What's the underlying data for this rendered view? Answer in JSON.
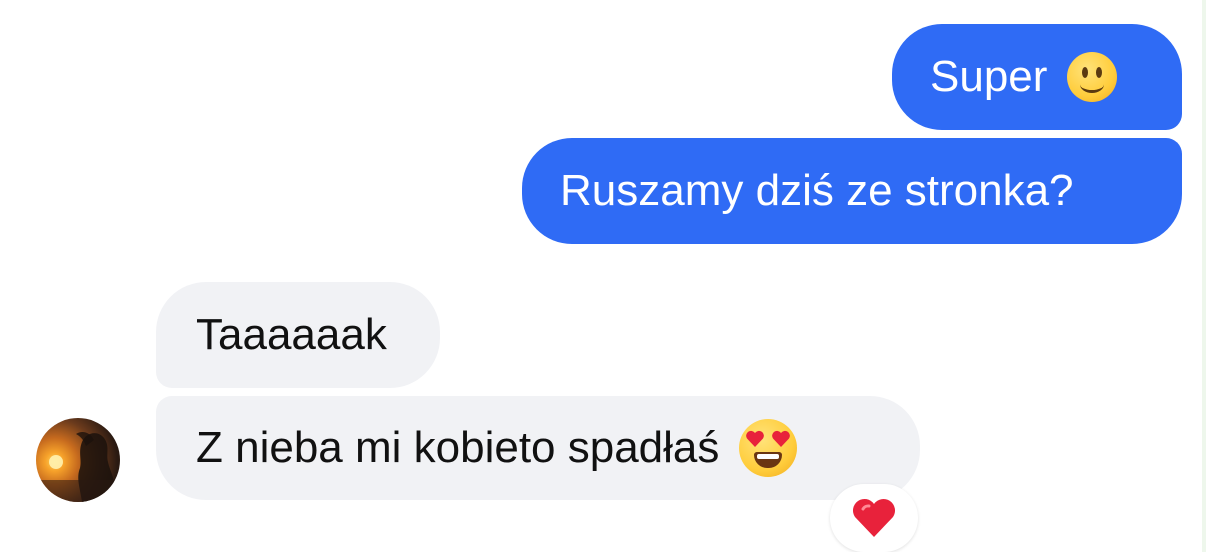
{
  "conversation": {
    "messages": [
      {
        "direction": "outgoing",
        "text": "Super",
        "emoji": "slightly-smiling-face-icon"
      },
      {
        "direction": "outgoing",
        "text": "Ruszamy dziś ze stronka?"
      },
      {
        "direction": "incoming",
        "text": "Taaaaaak"
      },
      {
        "direction": "incoming",
        "text": "Z nieba mi kobieto spadłaś",
        "emoji": "smiling-face-with-heart-eyes-icon",
        "reaction": "red-heart-icon"
      }
    ],
    "colors": {
      "outgoing_bubble": "#2f6bf5",
      "incoming_bubble": "#f1f2f5",
      "outgoing_text": "#ffffff",
      "incoming_text": "#111111",
      "reaction_heart": "#e8223b"
    },
    "avatar": {
      "icon": "contact-avatar-photo"
    }
  }
}
